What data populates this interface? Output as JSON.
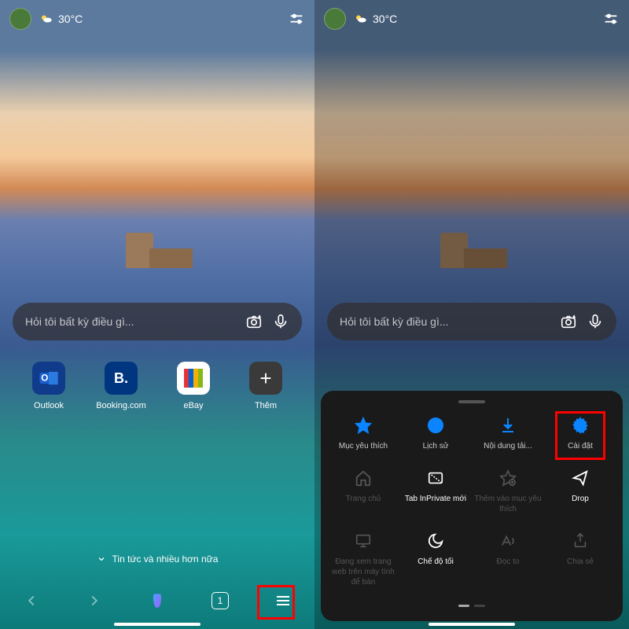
{
  "topbar": {
    "temperature": "30°C"
  },
  "search": {
    "placeholder": "Hỏi tôi bất kỳ điều gì..."
  },
  "quicklinks": [
    {
      "label": "Outlook",
      "bg": "#0f3b8a",
      "letter": "O"
    },
    {
      "label": "Booking.com",
      "bg": "#003580",
      "letter": "B."
    },
    {
      "label": "eBay",
      "bg": "#f0f0f0",
      "letter": ""
    },
    {
      "label": "Thêm",
      "bg": "#3a3a3a",
      "letter": "+"
    }
  ],
  "news": {
    "label": "Tin tức và nhiều hơn nữa"
  },
  "bottomnav": {
    "tab_count": "1"
  },
  "sheet": {
    "row1": [
      {
        "label": "Mục yêu thích",
        "icon": "star"
      },
      {
        "label": "Lịch sử",
        "icon": "history"
      },
      {
        "label": "Nội dung tải...",
        "icon": "download"
      },
      {
        "label": "Cài đặt",
        "icon": "gear"
      }
    ],
    "row2": [
      {
        "label": "Trang chủ",
        "icon": "home"
      },
      {
        "label": "Tab InPrivate mới",
        "icon": "inprivate"
      },
      {
        "label": "Thêm vào mục yêu thích",
        "icon": "star-add"
      },
      {
        "label": "Drop",
        "icon": "send"
      }
    ],
    "row3": [
      {
        "label": "Đang xem trang web trên máy tính để bàn",
        "icon": "desktop"
      },
      {
        "label": "Chế độ tối",
        "icon": "moon"
      },
      {
        "label": "Đọc to",
        "icon": "read"
      },
      {
        "label": "Chia sẻ",
        "icon": "share"
      }
    ]
  }
}
